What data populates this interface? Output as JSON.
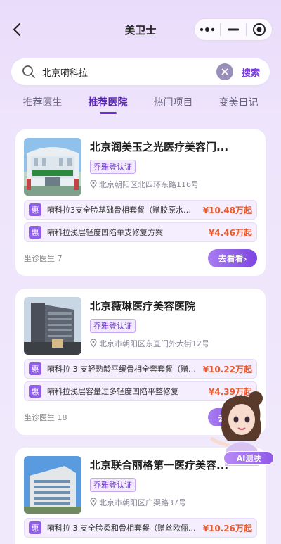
{
  "nav": {
    "title": "美卫士"
  },
  "search": {
    "value": "北京嗬科拉",
    "button": "搜索"
  },
  "tabs": [
    "推荐医生",
    "推荐医院",
    "热门项目",
    "变美日记"
  ],
  "active_tab": 1,
  "colors": {
    "accent": "#7b3fe0",
    "price": "#ef5a2b",
    "badge": "#8f5ee8"
  },
  "cards": [
    {
      "title": "北京润美玉之光医疗美容门...",
      "cert": "乔雅登认证",
      "address": "北京朝阳区北四环东路116号",
      "items": [
        {
          "badge": "惠",
          "name": "嗬科拉3支全脸基础骨相套餐（赠胶原水光1...",
          "price": "¥10.48万起"
        },
        {
          "badge": "惠",
          "name": "嗬科拉浅层轻度凹陷单支修复方案",
          "price": "¥4.46万起"
        }
      ],
      "doctors": "坐诊医生 7",
      "button": "去看看›"
    },
    {
      "title": "北京薇琳医疗美容医院",
      "cert": "乔雅登认证",
      "address": "北京市朝阳区东直门外大街12号",
      "items": [
        {
          "badge": "惠",
          "name": "嗬科拉 3 支轻熟龄平缓骨相全套套餐（赠颈...",
          "price": "¥10.22万起"
        },
        {
          "badge": "惠",
          "name": "嗬科拉浅层容量过多轻度凹陷平整修复",
          "price": "¥4.39万起"
        }
      ],
      "doctors": "坐诊医生 18",
      "button": "去看看›"
    },
    {
      "title": "北京联合丽格第一医疗美容...",
      "cert": "乔雅登认证",
      "address": "北京市朝阳区广渠路37号",
      "items": [
        {
          "badge": "惠",
          "name": "嗬科拉 3 支全脸柔和骨相套餐（赠丝欧俪...",
          "price": "¥10.26万起"
        }
      ],
      "doctors": "",
      "button": ""
    }
  ],
  "ai_button": "AI测肤"
}
